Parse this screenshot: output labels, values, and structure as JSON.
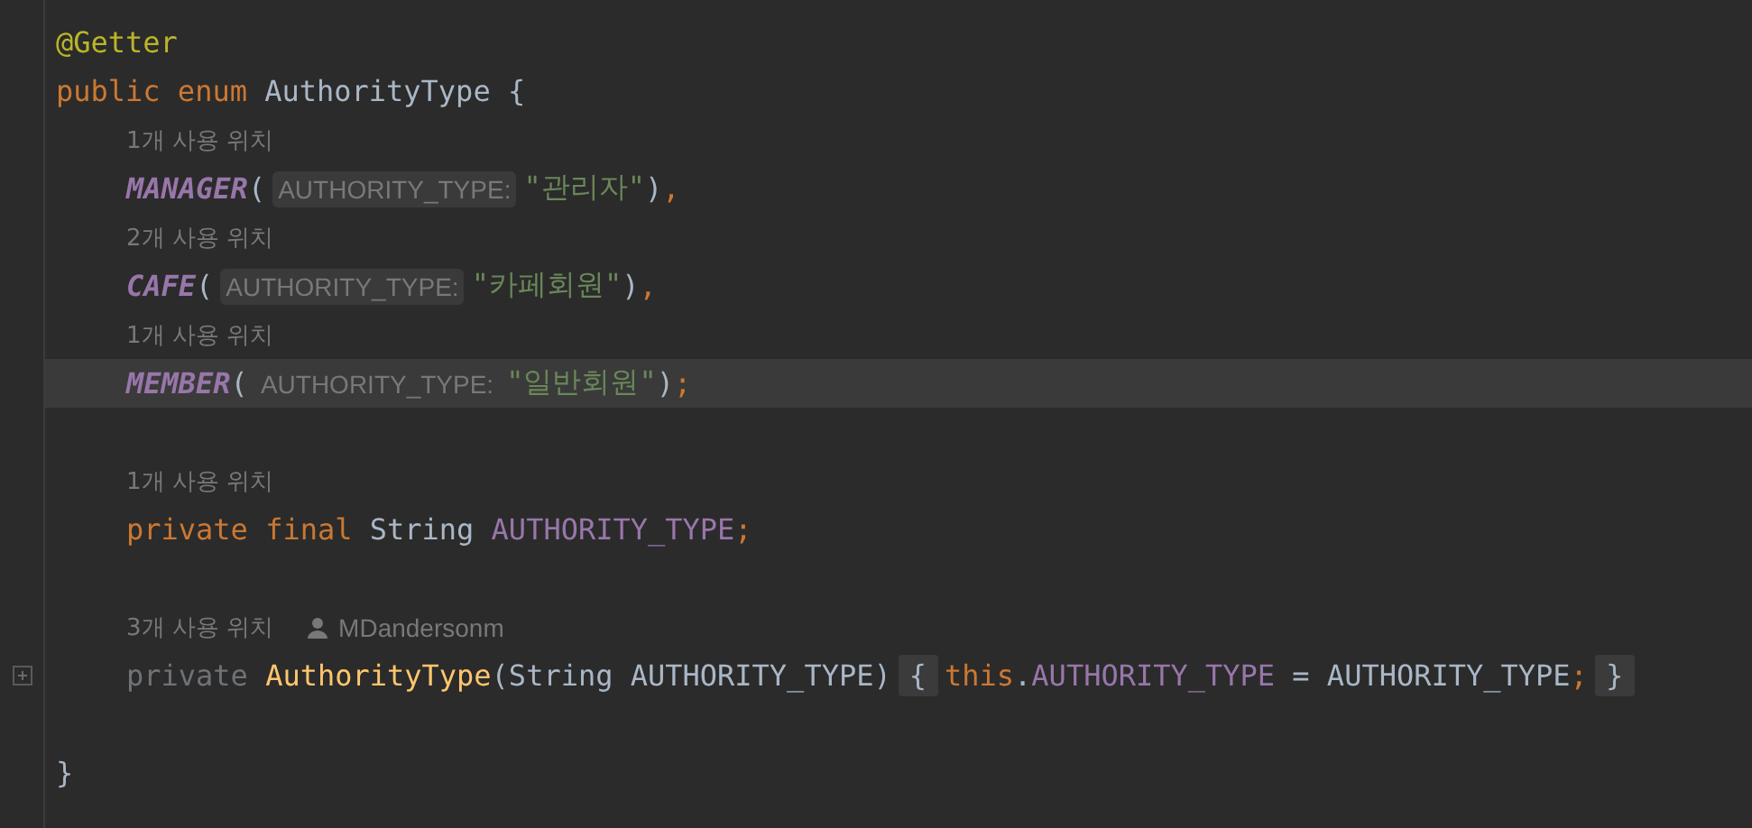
{
  "editor": {
    "lines": [
      {
        "kind": "code",
        "current": false,
        "tokens": [
          {
            "text": "@Getter",
            "kind": "annotation"
          }
        ]
      },
      {
        "kind": "code",
        "current": false,
        "tokens": [
          {
            "text": "public enum ",
            "kind": "keyword"
          },
          {
            "text": "AuthorityType {",
            "kind": "plain"
          }
        ],
        "children": [
          {
            "kind": "hint",
            "text": "1개 사용 위치"
          },
          {
            "kind": "code",
            "current": false,
            "tokens": [
              {
                "text": "MANAGER",
                "kind": "constant"
              },
              {
                "text": "(",
                "kind": "plain"
              },
              {
                "text": "AUTHORITY_TYPE:",
                "kind": "inlay"
              },
              {
                "text": "\"관리자\"",
                "kind": "string"
              },
              {
                "text": ")",
                "kind": "plain"
              },
              {
                "text": ",",
                "kind": "punct"
              }
            ]
          },
          {
            "kind": "hint",
            "text": "2개 사용 위치"
          },
          {
            "kind": "code",
            "current": false,
            "tokens": [
              {
                "text": "CAFE",
                "kind": "constant"
              },
              {
                "text": "(",
                "kind": "plain"
              },
              {
                "text": "AUTHORITY_TYPE:",
                "kind": "inlay"
              },
              {
                "text": "\"카페회원\"",
                "kind": "string"
              },
              {
                "text": ")",
                "kind": "plain"
              },
              {
                "text": ",",
                "kind": "punct"
              }
            ]
          },
          {
            "kind": "hint",
            "text": "1개 사용 위치"
          },
          {
            "kind": "code",
            "current": true,
            "tokens": [
              {
                "text": "MEMBER",
                "kind": "constant"
              },
              {
                "text": "(",
                "kind": "plain"
              },
              {
                "text": "AUTHORITY_TYPE:",
                "kind": "inlay"
              },
              {
                "text": "\"일반회원\"",
                "kind": "string"
              },
              {
                "text": ")",
                "kind": "plain"
              },
              {
                "text": ";",
                "kind": "punct"
              }
            ]
          },
          {
            "kind": "blank"
          },
          {
            "kind": "hint",
            "text": "1개 사용 위치"
          },
          {
            "kind": "code",
            "current": false,
            "tokens": [
              {
                "text": "private final ",
                "kind": "keyword"
              },
              {
                "text": "String ",
                "kind": "plain"
              },
              {
                "text": "AUTHORITY_TYPE",
                "kind": "field"
              },
              {
                "text": ";",
                "kind": "punct"
              }
            ]
          },
          {
            "kind": "blank"
          },
          {
            "kind": "hint",
            "text": "3개 사용 위치",
            "author": "MDandersonm"
          },
          {
            "kind": "code",
            "current": false,
            "foldable": true,
            "tokens": [
              {
                "text": "private ",
                "kind": "dim"
              },
              {
                "text": "AuthorityType",
                "kind": "method"
              },
              {
                "text": "(String AUTHORITY_TYPE)",
                "kind": "plain"
              },
              {
                "text": "{",
                "kind": "brace"
              },
              {
                "text": "this",
                "kind": "keyword"
              },
              {
                "text": ".",
                "kind": "plain"
              },
              {
                "text": "AUTHORITY_TYPE",
                "kind": "field"
              },
              {
                "text": " = AUTHORITY_TYPE",
                "kind": "plain"
              },
              {
                "text": ";",
                "kind": "punct"
              },
              {
                "text": "}",
                "kind": "brace"
              }
            ]
          },
          {
            "kind": "blank"
          }
        ]
      },
      {
        "kind": "code",
        "current": false,
        "tokens": [
          {
            "text": "}",
            "kind": "plain"
          }
        ]
      }
    ]
  }
}
